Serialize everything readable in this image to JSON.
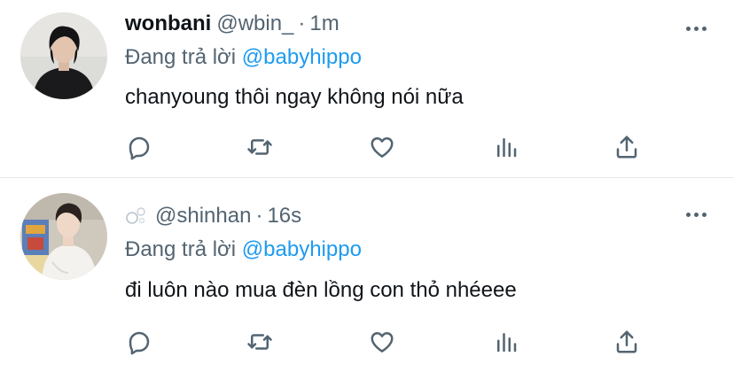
{
  "tweets": [
    {
      "display_name": "wonbani",
      "handle": "@wbin_",
      "separator": "·",
      "time": "1m",
      "reply_prefix": "Đang trả lời",
      "reply_to": "@babyhippo",
      "text": "chanyoung thôi ngay không nói nữa",
      "avatar_icon": "person-dark-clothes-avatar"
    },
    {
      "display_name": "",
      "handle": "@shinhan",
      "separator": "·",
      "time": "16s",
      "reply_prefix": "Đang trả lời",
      "reply_to": "@babyhippo",
      "text": "đi luôn nào mua đèn lồng con thỏ nhéeee",
      "avatar_icon": "person-white-sweater-avatar",
      "name_icon": "bubbles-icon"
    }
  ],
  "colors": {
    "text_primary": "#0f1419",
    "text_secondary": "#536471",
    "link": "#1d9bf0",
    "divider": "#e3e8ec",
    "background": "#ffffff"
  },
  "action_icons": [
    "reply-icon",
    "retweet-icon",
    "like-icon",
    "analytics-icon",
    "share-icon"
  ]
}
